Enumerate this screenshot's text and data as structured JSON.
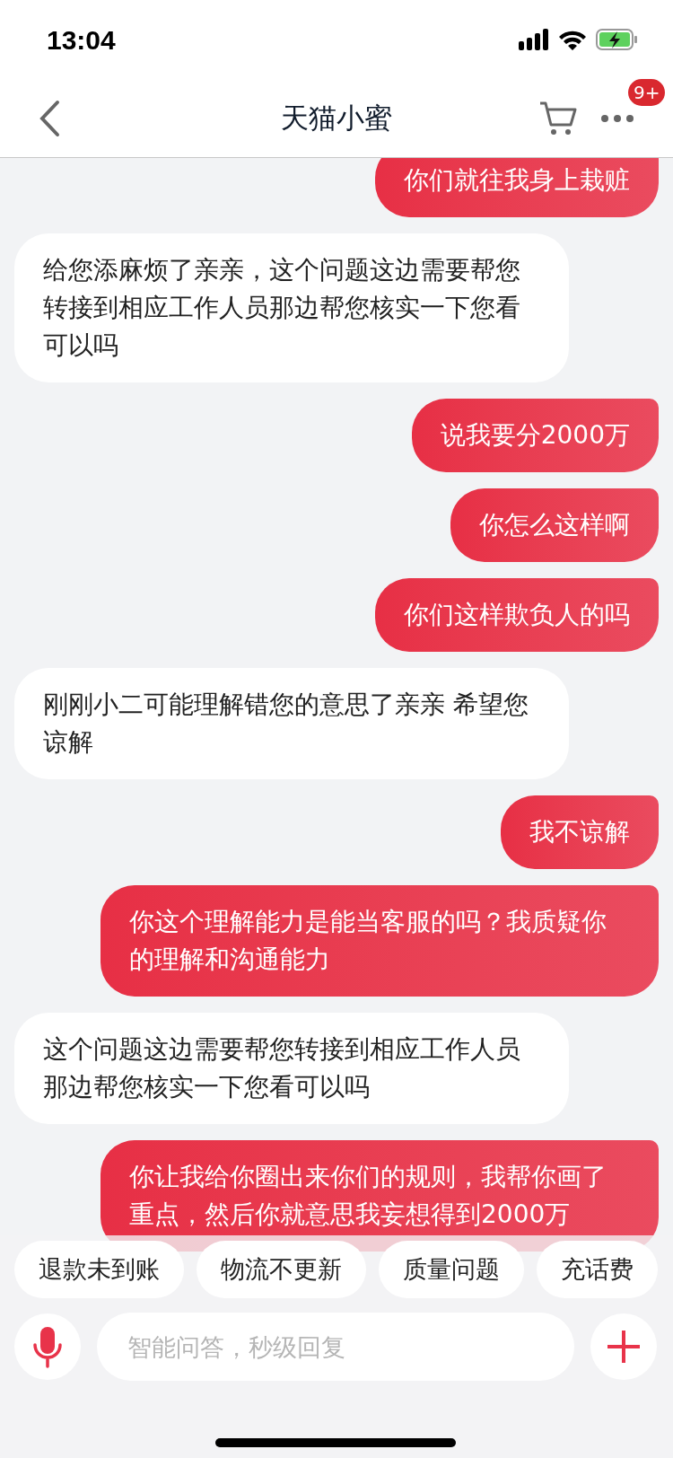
{
  "status_bar": {
    "time": "13:04"
  },
  "header": {
    "title": "天猫小蜜",
    "badge": "9+"
  },
  "messages": [
    {
      "kind": "user",
      "text": "你们就往我身上栽赃"
    },
    {
      "kind": "agent",
      "text": "给您添麻烦了亲亲，这个问题这边需要帮您转接到相应工作人员那边帮您核实一下您看可以吗"
    },
    {
      "kind": "user",
      "text": "说我要分2000万"
    },
    {
      "kind": "user",
      "text": "你怎么这样啊"
    },
    {
      "kind": "user",
      "text": "你们这样欺负人的吗"
    },
    {
      "kind": "agent",
      "text": "刚刚小二可能理解错您的意思了亲亲 希望您谅解"
    },
    {
      "kind": "user",
      "text": "我不谅解"
    },
    {
      "kind": "user",
      "text": "你这个理解能力是能当客服的吗？我质疑你的理解和沟通能力"
    },
    {
      "kind": "agent",
      "text": "这个问题这边需要帮您转接到相应工作人员那边帮您核实一下您看可以吗"
    },
    {
      "kind": "user",
      "text": "你让我给你圈出来你们的规则，我帮你画了重点，然后你就意思我妄想得到2000万"
    }
  ],
  "quick_replies": [
    "退款未到账",
    "物流不更新",
    "质量问题",
    "充话费"
  ],
  "input": {
    "placeholder": "智能问答，秒级回复"
  }
}
